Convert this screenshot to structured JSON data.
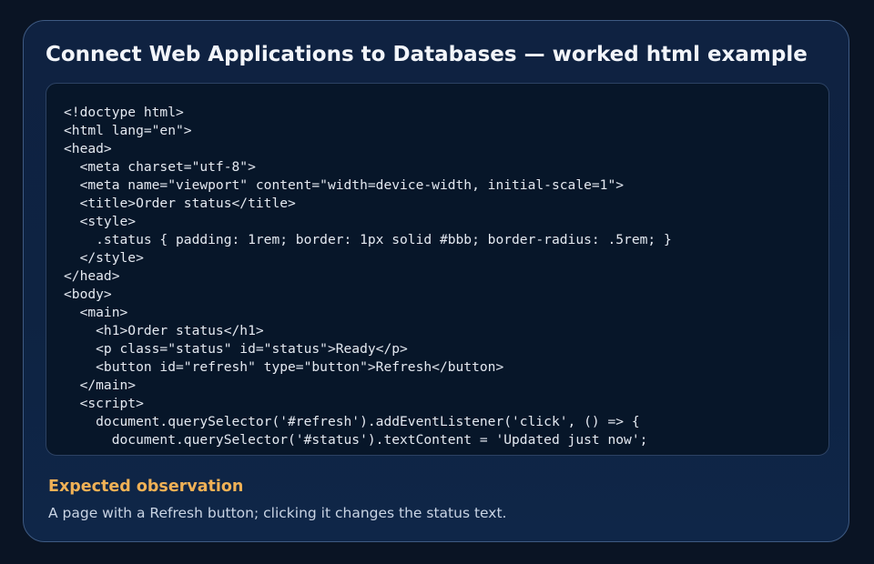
{
  "card": {
    "title": "Connect Web Applications to Databases — worked html example",
    "code_lines": [
      "<!doctype html>",
      "<html lang=\"en\">",
      "<head>",
      "  <meta charset=\"utf-8\">",
      "  <meta name=\"viewport\" content=\"width=device-width, initial-scale=1\">",
      "  <title>Order status</title>",
      "  <style>",
      "    .status { padding: 1rem; border: 1px solid #bbb; border-radius: .5rem; }",
      "  </style>",
      "</head>",
      "<body>",
      "  <main>",
      "    <h1>Order status</h1>",
      "    <p class=\"status\" id=\"status\">Ready</p>",
      "    <button id=\"refresh\" type=\"button\">Refresh</button>",
      "  </main>",
      "  <script>",
      "    document.querySelector('#refresh').addEventListener('click', () => {",
      "      document.querySelector('#status').textContent = 'Updated just now';"
    ],
    "observation_heading": "Expected observation",
    "observation_text": "A page with a Refresh button; clicking it changes the status text."
  },
  "colors": {
    "background": "#0a1424",
    "card_background": "#0f2241",
    "card_border": "#3e5a82",
    "code_background": "#071629",
    "accent": "#f0b156",
    "title_text": "#f2f5fa"
  }
}
